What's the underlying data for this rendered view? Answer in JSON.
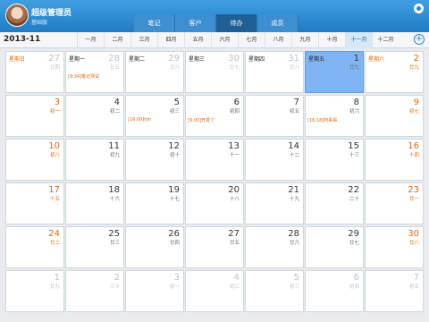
{
  "header": {
    "user_name": "超级管理员",
    "user_subtitle": "基础版",
    "tabs": [
      {
        "label": "笔记",
        "active": false
      },
      {
        "label": "客户",
        "active": false
      },
      {
        "label": "待办",
        "active": true
      },
      {
        "label": "成员",
        "active": false
      }
    ]
  },
  "monthbar": {
    "current": "2013-11",
    "months": [
      "一月",
      "二月",
      "三月",
      "四月",
      "五月",
      "六月",
      "七月",
      "八月",
      "九月",
      "十月",
      "十一月",
      "十二月"
    ],
    "selected_index": 10
  },
  "calendar": {
    "weeks": [
      [
        {
          "wk": "星期日",
          "d": "27",
          "l": "廿四",
          "dim": true
        },
        {
          "wk": "星期一",
          "d": "28",
          "l": "廿五",
          "dim": true,
          "ev": "[9:34]笔记测试"
        },
        {
          "wk": "星期二",
          "d": "29",
          "l": "廿六",
          "dim": true
        },
        {
          "wk": "星期三",
          "d": "30",
          "l": "廿七",
          "dim": true
        },
        {
          "wk": "星期四",
          "d": "31",
          "l": "廿八",
          "dim": true
        },
        {
          "wk": "星期五",
          "d": "1",
          "l": "廿九",
          "today": true
        },
        {
          "wk": "星期六",
          "d": "2",
          "l": "廿九",
          "weekend": true
        }
      ],
      [
        {
          "d": "3",
          "l": "初一",
          "weekend": true
        },
        {
          "d": "4",
          "l": "初二"
        },
        {
          "d": "5",
          "l": "初三",
          "ev": "[16:00]hjh"
        },
        {
          "d": "6",
          "l": "初四",
          "ev": "[9:00]开发了"
        },
        {
          "d": "7",
          "l": "初五"
        },
        {
          "d": "8",
          "l": "初六",
          "ev": "[16:18]阿事事"
        },
        {
          "d": "9",
          "l": "初七",
          "weekend": true
        }
      ],
      [
        {
          "d": "10",
          "l": "初八",
          "weekend": true
        },
        {
          "d": "11",
          "l": "初九"
        },
        {
          "d": "12",
          "l": "初十"
        },
        {
          "d": "13",
          "l": "十一"
        },
        {
          "d": "14",
          "l": "十二"
        },
        {
          "d": "15",
          "l": "十三"
        },
        {
          "d": "16",
          "l": "十四",
          "weekend": true
        }
      ],
      [
        {
          "d": "17",
          "l": "十五",
          "weekend": true
        },
        {
          "d": "18",
          "l": "十六"
        },
        {
          "d": "19",
          "l": "十七"
        },
        {
          "d": "20",
          "l": "十八"
        },
        {
          "d": "21",
          "l": "十九"
        },
        {
          "d": "22",
          "l": "二十"
        },
        {
          "d": "23",
          "l": "廿一",
          "weekend": true
        }
      ],
      [
        {
          "d": "24",
          "l": "廿二",
          "weekend": true
        },
        {
          "d": "25",
          "l": "廿三"
        },
        {
          "d": "26",
          "l": "廿四"
        },
        {
          "d": "27",
          "l": "廿五"
        },
        {
          "d": "28",
          "l": "廿六"
        },
        {
          "d": "29",
          "l": "廿七"
        },
        {
          "d": "30",
          "l": "廿八",
          "weekend": true
        }
      ],
      [
        {
          "d": "1",
          "l": "廿九",
          "dim": true
        },
        {
          "d": "2",
          "l": "三十",
          "dim": true
        },
        {
          "d": "3",
          "l": "初一",
          "dim": true
        },
        {
          "d": "4",
          "l": "初二",
          "dim": true
        },
        {
          "d": "5",
          "l": "初三",
          "dim": true
        },
        {
          "d": "6",
          "l": "初四",
          "dim": true
        },
        {
          "d": "7",
          "l": "初五",
          "dim": true
        }
      ]
    ]
  }
}
